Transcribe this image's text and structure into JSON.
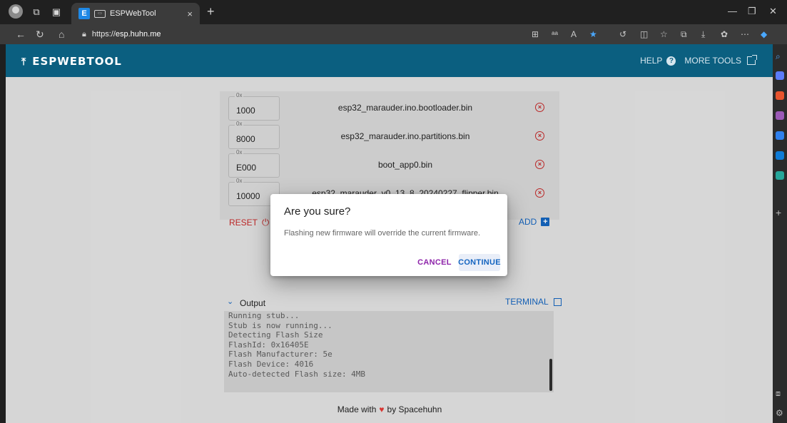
{
  "browser": {
    "tab_title": "ESPWebTool",
    "tab_favicon": "E",
    "tab_close": "×",
    "new_tab": "+",
    "url_prefix": "https://",
    "url_host": "esp.huhn.me"
  },
  "header": {
    "brand": "ESPWEBTOOL",
    "help_label": "HELP",
    "more_tools_label": "MORE TOOLS"
  },
  "partitions": [
    {
      "offset_label": "0x",
      "offset": "1000",
      "file": "esp32_marauder.ino.bootloader.bin"
    },
    {
      "offset_label": "0x",
      "offset": "8000",
      "file": "esp32_marauder.ino.partitions.bin"
    },
    {
      "offset_label": "0x",
      "offset": "E000",
      "file": "boot_app0.bin"
    },
    {
      "offset_label": "0x",
      "offset": "10000",
      "file": "esp32_marauder_v0_13_8_20240227_flipper.bin"
    }
  ],
  "actions": {
    "reset_label": "RESET",
    "add_label": "ADD"
  },
  "output": {
    "title": "Output",
    "terminal_label": "TERMINAL",
    "lines": [
      "Running stub...",
      "Stub is now running...",
      "Detecting Flash Size",
      "FlashId: 0x16405E",
      "Flash Manufacturer: 5e",
      "Flash Device: 4016",
      "Auto-detected Flash size: 4MB"
    ]
  },
  "footer": {
    "made_with": "Made with",
    "by": "by Spacehuhn"
  },
  "dialog": {
    "title": "Are you sure?",
    "message": "Flashing new firmware will override the current firmware.",
    "cancel_label": "CANCEL",
    "continue_label": "CONTINUE"
  },
  "colors": {
    "appbar": "#0b5f80",
    "danger": "#c62828",
    "primary": "#1565c0",
    "cancel": "#8e24aa"
  }
}
